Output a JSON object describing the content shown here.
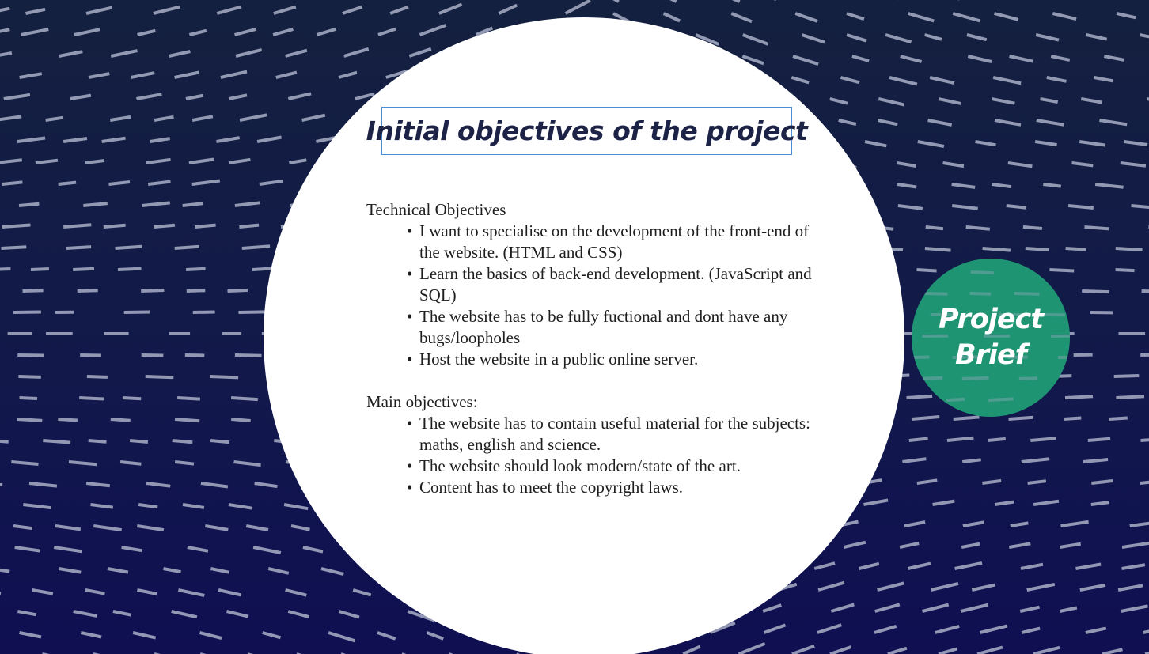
{
  "slide": {
    "title": "Initial objectives of the project",
    "badge": {
      "line1": "Project",
      "line2": "Brief"
    },
    "sections": [
      {
        "heading": "Technical Objectives",
        "bullets": [
          "I want to specialise on the development of the front-end of the website. (HTML and CSS)",
          "Learn the basics of back-end development. (JavaScript and SQL)",
          "The website has to be fully fuctional and dont have any bugs/loopholes",
          "Host the website in a public online server."
        ]
      },
      {
        "heading": "Main objectives:",
        "bullets": [
          "The website has to contain useful material for the subjects: maths, english and science.",
          "The website should look modern/state of the art.",
          "Content has to meet the copyright laws."
        ]
      }
    ],
    "bullet_glyph": "•"
  },
  "colors": {
    "background_top": "#14203f",
    "background_bottom": "#0f0f52",
    "circle": "#ffffff",
    "badge": "#1e9473",
    "title_border": "#4a8fd6",
    "title_text": "#1c2347",
    "dash": "#a9afc6"
  },
  "icons": {
    "background_pattern": "diagonal-dash-pattern"
  }
}
